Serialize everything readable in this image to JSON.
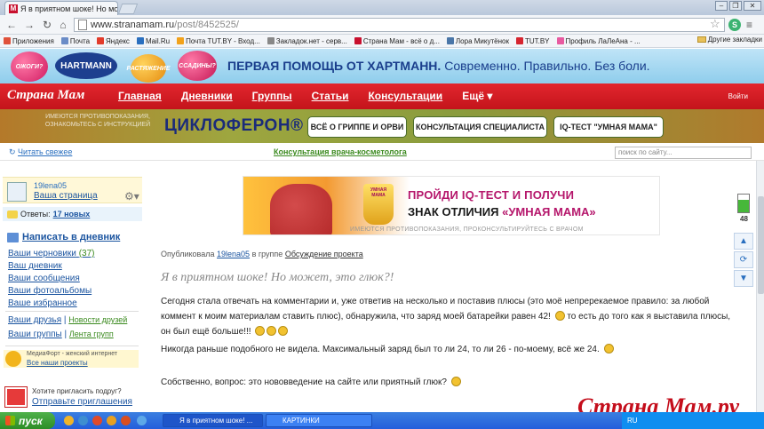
{
  "browser": {
    "tab_title": "Я в приятном шоке! Но мо...",
    "tab_favicon": "M",
    "url_domain": "www.stranamam.ru",
    "url_path": "/post/8452525/"
  },
  "bookmarks": [
    {
      "label": "Приложения",
      "color": "#e0513a"
    },
    {
      "label": "Почта",
      "color": "#6a8cc7"
    },
    {
      "label": "Яндекс",
      "color": "#e23b2b"
    },
    {
      "label": "Mail.Ru",
      "color": "#2a6fbf"
    },
    {
      "label": "Почта TUT.BY - Вход...",
      "color": "#f2a21b"
    },
    {
      "label": "Закладок.нет - серв...",
      "color": "#888888"
    },
    {
      "label": "Страна Мам - всё о д...",
      "color": "#c8102e"
    },
    {
      "label": "Лора Микутёнок",
      "color": "#4a76a8"
    },
    {
      "label": "TUT.BY",
      "color": "#d6252f"
    },
    {
      "label": "Профиль ЛаЛеАна - ...",
      "color": "#e85aa0"
    }
  ],
  "bookmarks_other": "Другие закладки",
  "banner": {
    "balloons": [
      "ОЖОГИ?",
      "РАСТЯЖЕНИЕ",
      "ССАДИНЫ?"
    ],
    "hartmann": "HARTMANN",
    "title_bold": "ПЕРВАЯ ПОМОЩЬ ОТ ХАРТМАНН.",
    "title_rest": "Современно. Правильно. Без боли."
  },
  "site": {
    "logo": "Страна Мам",
    "nav": [
      "Главная",
      "Дневники",
      "Группы",
      "Статьи",
      "Консультации",
      "Ещё ▾"
    ],
    "login": "Войти"
  },
  "cycloferon": {
    "warning": "ИМЕЮТСЯ ПРОТИВОПОКАЗАНИЯ, ОЗНАКОМЬТЕСЬ С ИНСТРУКЦИЕЙ",
    "brand": "ЦИКЛОФЕРОН®",
    "buttons": [
      "ВСЁ О ГРИППЕ И ОРВИ",
      "КОНСУЛЬТАЦИЯ СПЕЦИАЛИСТА",
      "IQ-ТЕСТ \"УМНАЯ МАМА\""
    ]
  },
  "subbar": {
    "refresh": "Читать свежее",
    "consult": "Консультация врача-косметолога",
    "search_placeholder": "поиск по сайту..."
  },
  "sidebar": {
    "username": "19lena05",
    "my_page": "Ваша страница",
    "answers_label": "Ответы:",
    "answers_new": "17 новых",
    "write": "Написать в дневник",
    "drafts": "Ваши черновики",
    "drafts_count": "(37)",
    "diary": "Ваш дневник",
    "messages": "Ваши сообщения",
    "albums": "Ваши фотоальбомы",
    "favorites": "Ваше избранное",
    "friends": "Ваши друзья",
    "friends_news": "Новости друзей",
    "groups": "Ваши группы",
    "groups_feed": "Лента групп",
    "mediafort_title": "МедиаФорт - женский интернет",
    "mediafort_link": "Все наши проекты",
    "invite_q": "Хотите пригласить подруг?",
    "invite_a": "Отправьте приглашения"
  },
  "promo": {
    "cup_text": "УМНАЯ МАМА",
    "line1": "ПРОЙДИ IQ-ТЕСТ И ПОЛУЧИ",
    "line2_a": "ЗНАК ОТЛИЧИЯ ",
    "line2_b": "«УМНАЯ МАМА»",
    "disclaimer": "ИМЕЮТСЯ ПРОТИВОПОКАЗАНИЯ, ПРОКОНСУЛЬТИРУЙТЕСЬ С ВРАЧОМ"
  },
  "post": {
    "published_by": "Опубликовала",
    "author": "19lena05",
    "in_group": "в группе",
    "group": "Обсуждение проекта",
    "title": "Я в приятном шоке! Но может, это глюк?!",
    "p1a": "Сегодня стала отвечать на комментарии и, уже ответив на несколько и поставив плюсы (это моё непререкаемое правило: за любой",
    "p1b": "коммент к моим материалам ставить плюс), обнаружила, что заряд моей батарейки равен 42!",
    "p1c": "то есть до того как я выставила плюсы,",
    "p1d": "он был ещё больше!!!",
    "p2": "Никогда раньше подобного не видела. Максимальный заряд был то ли 24, то ли 26 - по-моему, всё же 24.",
    "p3": "Собственно, вопрос: это нововведение на сайте или приятный глюк?"
  },
  "battery_charge": "48",
  "watermark": "Страна Мам.ру",
  "taskbar": {
    "start": "пуск",
    "tasks": [
      "Я в приятном шоке! ...",
      "КАРТИНКИ"
    ],
    "tray": "RU"
  }
}
